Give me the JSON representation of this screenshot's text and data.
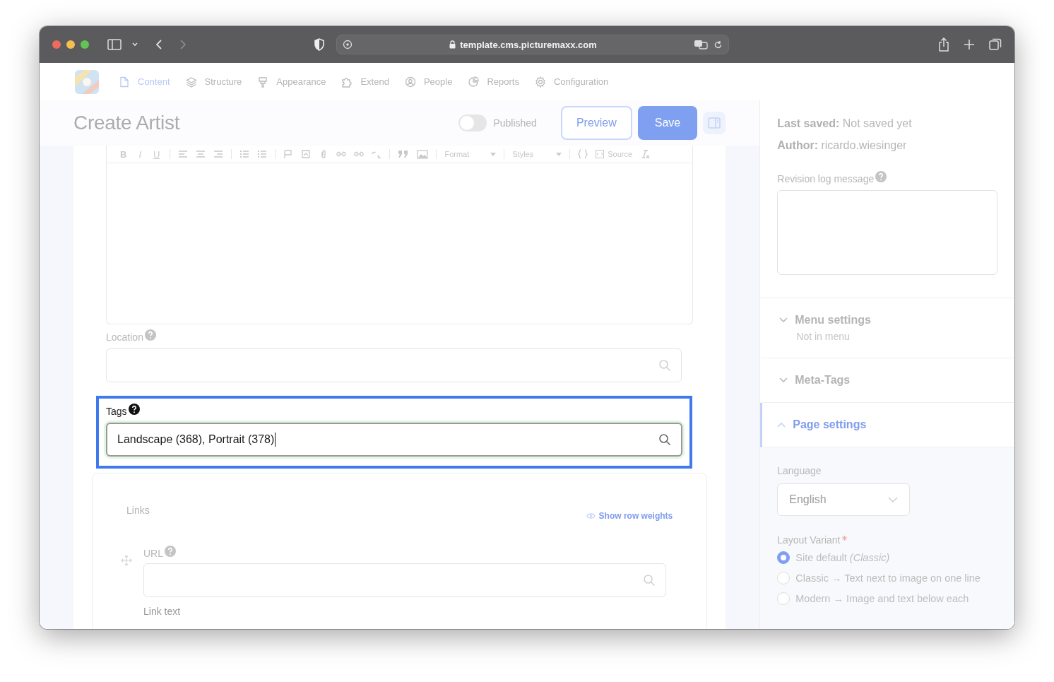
{
  "browser": {
    "url": "template.cms.picturemaxx.com"
  },
  "nav": [
    {
      "label": "Content",
      "selected": true
    },
    {
      "label": "Structure",
      "selected": false
    },
    {
      "label": "Appearance",
      "selected": false
    },
    {
      "label": "Extend",
      "selected": false
    },
    {
      "label": "People",
      "selected": false
    },
    {
      "label": "Reports",
      "selected": false
    },
    {
      "label": "Configuration",
      "selected": false
    }
  ],
  "header": {
    "title": "Create Artist",
    "published": {
      "label": "Published",
      "on": false
    },
    "preview": "Preview",
    "save": "Save"
  },
  "editor": {
    "marks": [
      "B",
      "I",
      "U"
    ],
    "format": "Format",
    "styles": "Styles",
    "source": "Source"
  },
  "location": {
    "label": "Location"
  },
  "tags": {
    "label": "Tags",
    "value": "Landscape (368), Portrait (378)",
    "highlighted": true
  },
  "links": {
    "title": "Links",
    "show_weights": "Show row weights",
    "url_label": "URL",
    "link_text_label": "Link text"
  },
  "sidebar": {
    "last_saved": {
      "label": "Last saved:",
      "value": "Not saved yet"
    },
    "author": {
      "label": "Author:",
      "value": "ricardo.wiesinger"
    },
    "revision_label": "Revision log message",
    "sections": [
      {
        "title": "Menu settings",
        "expanded": false,
        "subtitle": "Not in menu"
      },
      {
        "title": "Meta-Tags",
        "expanded": false
      },
      {
        "title": "Page settings",
        "expanded": true
      }
    ],
    "language": {
      "label": "Language",
      "value": "English"
    },
    "layout_variant": {
      "label": "Layout Variant",
      "required": true,
      "options": [
        {
          "label": "Site default *(Classic)*",
          "selected": true
        },
        {
          "label": "Classic → Text next to image on one line",
          "selected": false
        },
        {
          "label": "Modern → Image and text below each",
          "selected": false
        }
      ]
    }
  }
}
